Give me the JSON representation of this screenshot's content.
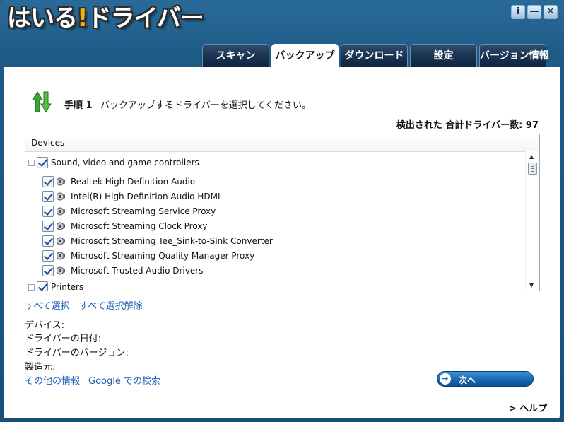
{
  "app": {
    "logo_text": "はいる",
    "logo_bang": "!",
    "logo_text2": "ドライバー"
  },
  "window_buttons": {
    "info": "i",
    "minimize": "—",
    "close": "✕"
  },
  "tabs": [
    {
      "label": "スキャン",
      "active": false
    },
    {
      "label": "バックアップ",
      "active": true
    },
    {
      "label": "ダウンロード",
      "active": false
    },
    {
      "label": "設定",
      "active": false
    },
    {
      "label": "バージョン情報",
      "active": false
    }
  ],
  "step": {
    "label": "手順 1",
    "description": "バックアップするドライバーを選択してください。"
  },
  "total_drivers": "検出された 合計ドライバー数: 97",
  "device_list": {
    "header": "Devices",
    "categories": [
      {
        "name": "Sound, video and game controllers",
        "checked": true,
        "items": [
          "Realtek High Definition Audio",
          "Intel(R) High Definition Audio HDMI",
          "Microsoft Streaming Service Proxy",
          "Microsoft Streaming Clock Proxy",
          "Microsoft Streaming Tee_Sink-to-Sink Converter",
          "Microsoft Streaming Quality Manager Proxy",
          "Microsoft Trusted Audio Drivers"
        ]
      },
      {
        "name": "Printers",
        "checked": true,
        "items": []
      }
    ]
  },
  "links": {
    "select_all": "すべて選択",
    "deselect_all": "すべて選択解除"
  },
  "details": {
    "device": "デバイス:",
    "driver_date": "ドライバーの日付:",
    "driver_version": "ドライバーのバージョン:",
    "manufacturer": "製造元:"
  },
  "bottom_links": {
    "more_info": "その他の情報",
    "google_search": "Google での検索"
  },
  "next_button": "次へ",
  "help": "> ヘルプ",
  "colors": {
    "window_blue": "#1d5b86",
    "tab_dark": "#1a3552",
    "link": "#1a5fb4",
    "button_blue": "#1565b0"
  }
}
